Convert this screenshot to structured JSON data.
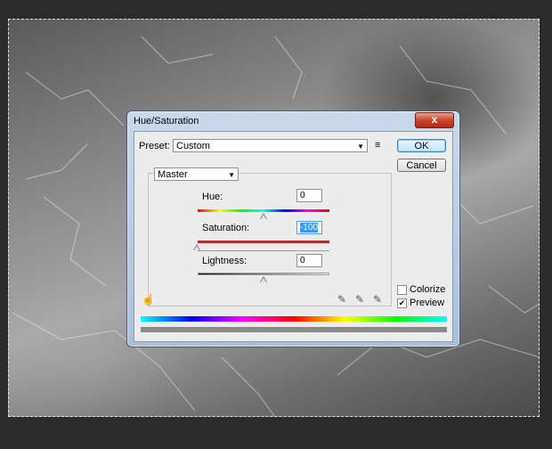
{
  "dialog": {
    "title": "Hue/Saturation",
    "close_label": "x"
  },
  "preset": {
    "label": "Preset:",
    "value": "Custom"
  },
  "buttons": {
    "ok": "OK",
    "cancel": "Cancel"
  },
  "channel": {
    "value": "Master"
  },
  "hue": {
    "label": "Hue:",
    "value": "0"
  },
  "saturation": {
    "label": "Saturation:",
    "value": "-100"
  },
  "lightness": {
    "label": "Lightness:",
    "value": "0"
  },
  "options": {
    "colorize": "Colorize",
    "preview": "Preview",
    "colorize_checked": false,
    "preview_checked": true
  },
  "icons": [
    "hand-adjust-icon",
    "eyedropper-icon",
    "eyedropper-plus-icon",
    "eyedropper-minus-icon",
    "preset-menu-icon"
  ]
}
